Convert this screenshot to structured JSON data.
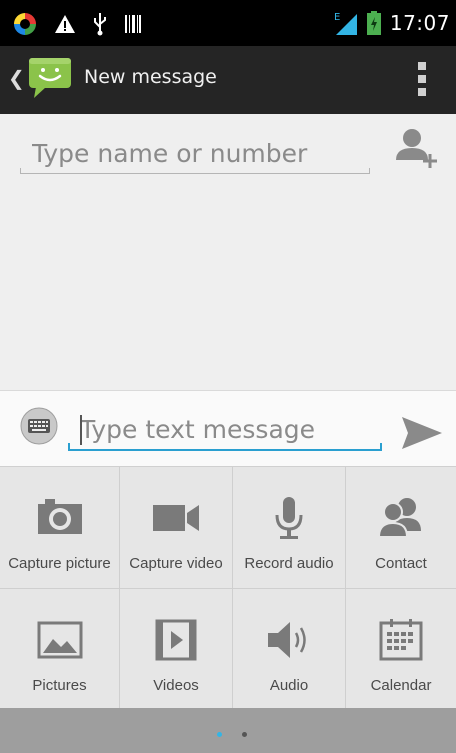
{
  "status_bar": {
    "time": "17:07",
    "left_icons": [
      "color-wheel-icon",
      "warning-icon",
      "usb-icon",
      "barcode-icon"
    ],
    "right_icons": [
      "signal-icon",
      "battery-icon"
    ],
    "network_label": "E"
  },
  "action_bar": {
    "title": "New message",
    "icons": [
      "back-caret-icon",
      "messaging-app-icon",
      "overflow-menu-icon"
    ]
  },
  "recipient": {
    "placeholder": "Type name or number",
    "value": ""
  },
  "compose": {
    "placeholder": "Type text message",
    "value": ""
  },
  "attachments": [
    {
      "label": "Capture picture",
      "icon": "camera-icon"
    },
    {
      "label": "Capture video",
      "icon": "video-camera-icon"
    },
    {
      "label": "Record audio",
      "icon": "microphone-icon"
    },
    {
      "label": "Contact",
      "icon": "contacts-icon"
    },
    {
      "label": "Pictures",
      "icon": "picture-icon"
    },
    {
      "label": "Videos",
      "icon": "video-file-icon"
    },
    {
      "label": "Audio",
      "icon": "speaker-icon"
    },
    {
      "label": "Calendar",
      "icon": "calendar-icon"
    }
  ],
  "pager": {
    "pages": 2,
    "current_page": 1,
    "active_color": "#33b5e5",
    "inactive_color": "#555555"
  },
  "colors": {
    "accent": "#2a9fd0",
    "signal": "#33b5e5",
    "battery": "#4caf50",
    "app_icon_green": "#8bc34a"
  }
}
